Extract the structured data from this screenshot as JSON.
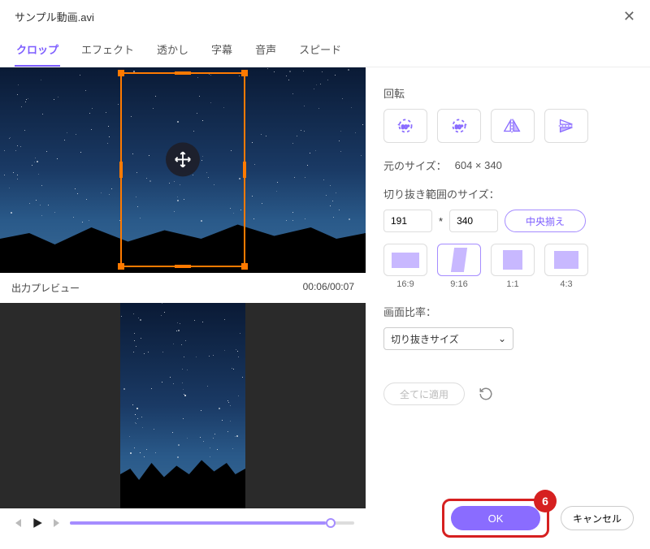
{
  "title": "サンプル動画.avi",
  "tabs": [
    "クロップ",
    "エフェクト",
    "透かし",
    "字幕",
    "音声",
    "スピード"
  ],
  "activeTab": 0,
  "preview": {
    "label": "出力プレビュー",
    "time": "00:06/00:07"
  },
  "rotate": {
    "label": "回転"
  },
  "origSize": {
    "label": "元のサイズ：",
    "value": "604 × 340"
  },
  "cropSize": {
    "label": "切り抜き範囲のサイズ：",
    "w": "191",
    "h": "340",
    "sep": "*",
    "center": "中央揃え"
  },
  "aspects": [
    {
      "label": "16:9"
    },
    {
      "label": "9:16"
    },
    {
      "label": "1:1"
    },
    {
      "label": "4:3"
    }
  ],
  "aspectSelected": 1,
  "ratio": {
    "label": "画面比率：",
    "value": "切り抜きサイズ"
  },
  "applyAll": "全てに適用",
  "ok": "OK",
  "cancel": "キャンセル",
  "badge": "6"
}
